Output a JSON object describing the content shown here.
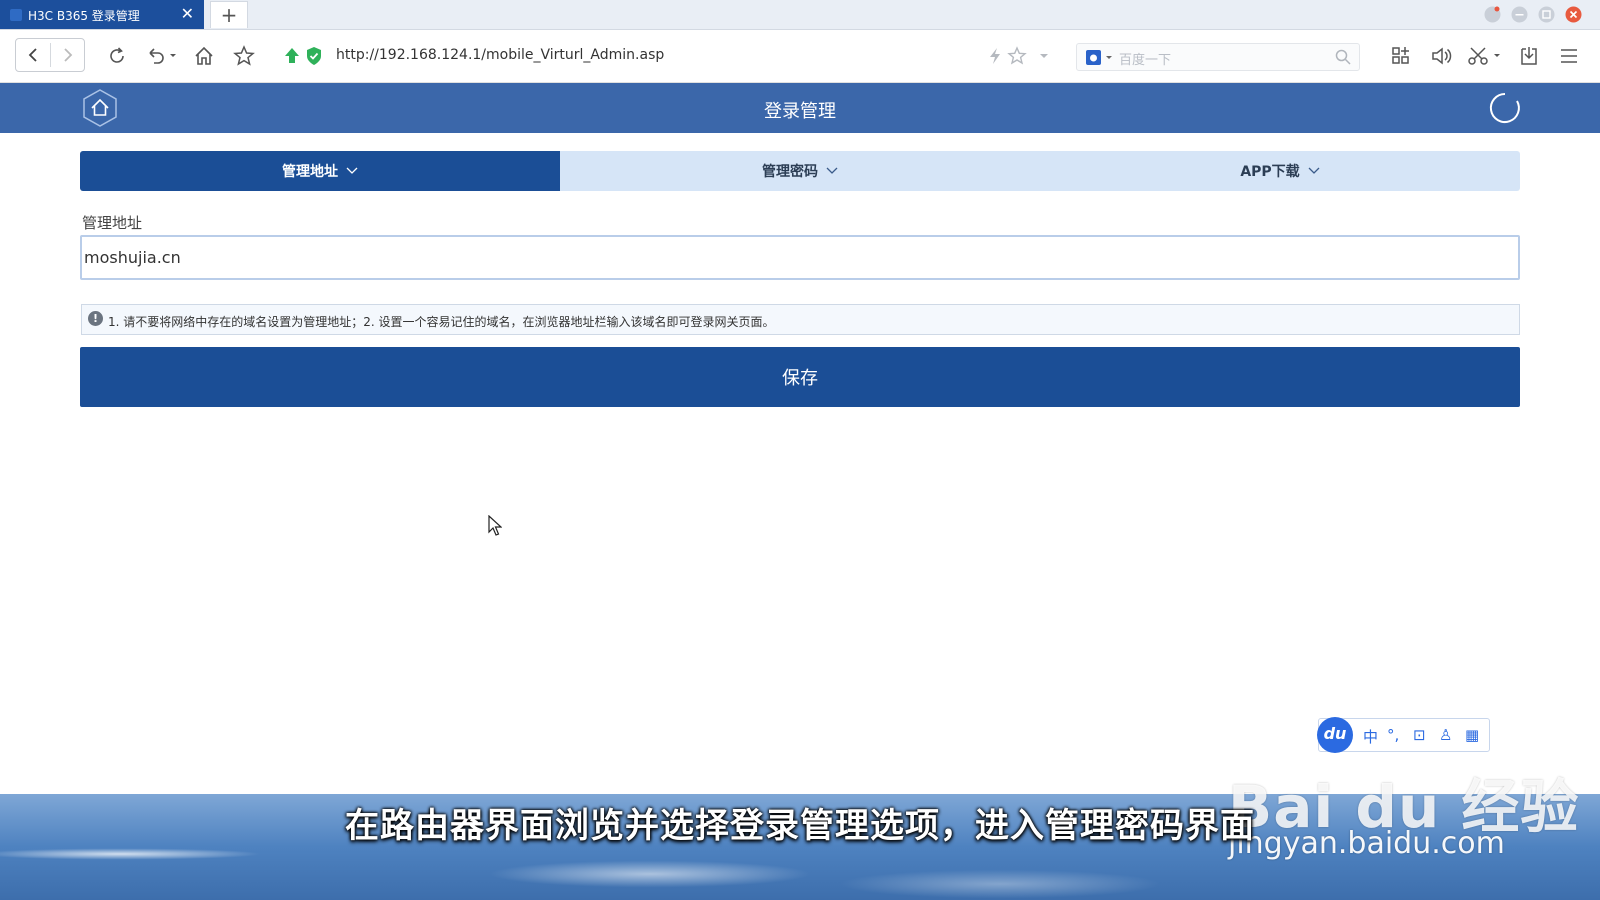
{
  "browser": {
    "tab_title": "H3C B365 登录管理",
    "tab_close": "✕",
    "new_tab": "+",
    "url": "http://192.168.124.1/mobile_Virturl_Admin.asp",
    "search_placeholder": "百度一下"
  },
  "page": {
    "header_title": "登录管理",
    "tabs": [
      {
        "label": "管理地址",
        "active": true
      },
      {
        "label": "管理密码",
        "active": false
      },
      {
        "label": "APP下载",
        "active": false
      }
    ],
    "field_label": "管理地址",
    "field_value": "moshujia.cn",
    "tip_icon": "!",
    "tip": "1. 请不要将网络中存在的域名设置为管理地址；2. 设置一个容易记住的域名，在浏览器地址栏输入该域名即可登录网关页面。",
    "save_label": "保存"
  },
  "ime": {
    "logo": "du",
    "items": [
      "中",
      "°,",
      "⊡",
      "♙",
      "▦"
    ]
  },
  "overlay": {
    "subtitle": "在路由器界面浏览并选择登录管理选项，进入管理密码界面",
    "watermark_logo": "Bai du 经验",
    "watermark_url": "jingyan.baidu.com"
  },
  "colors": {
    "header": "#3b67aa",
    "primary": "#1b4e96",
    "tab_bg": "#d6e5f7"
  }
}
